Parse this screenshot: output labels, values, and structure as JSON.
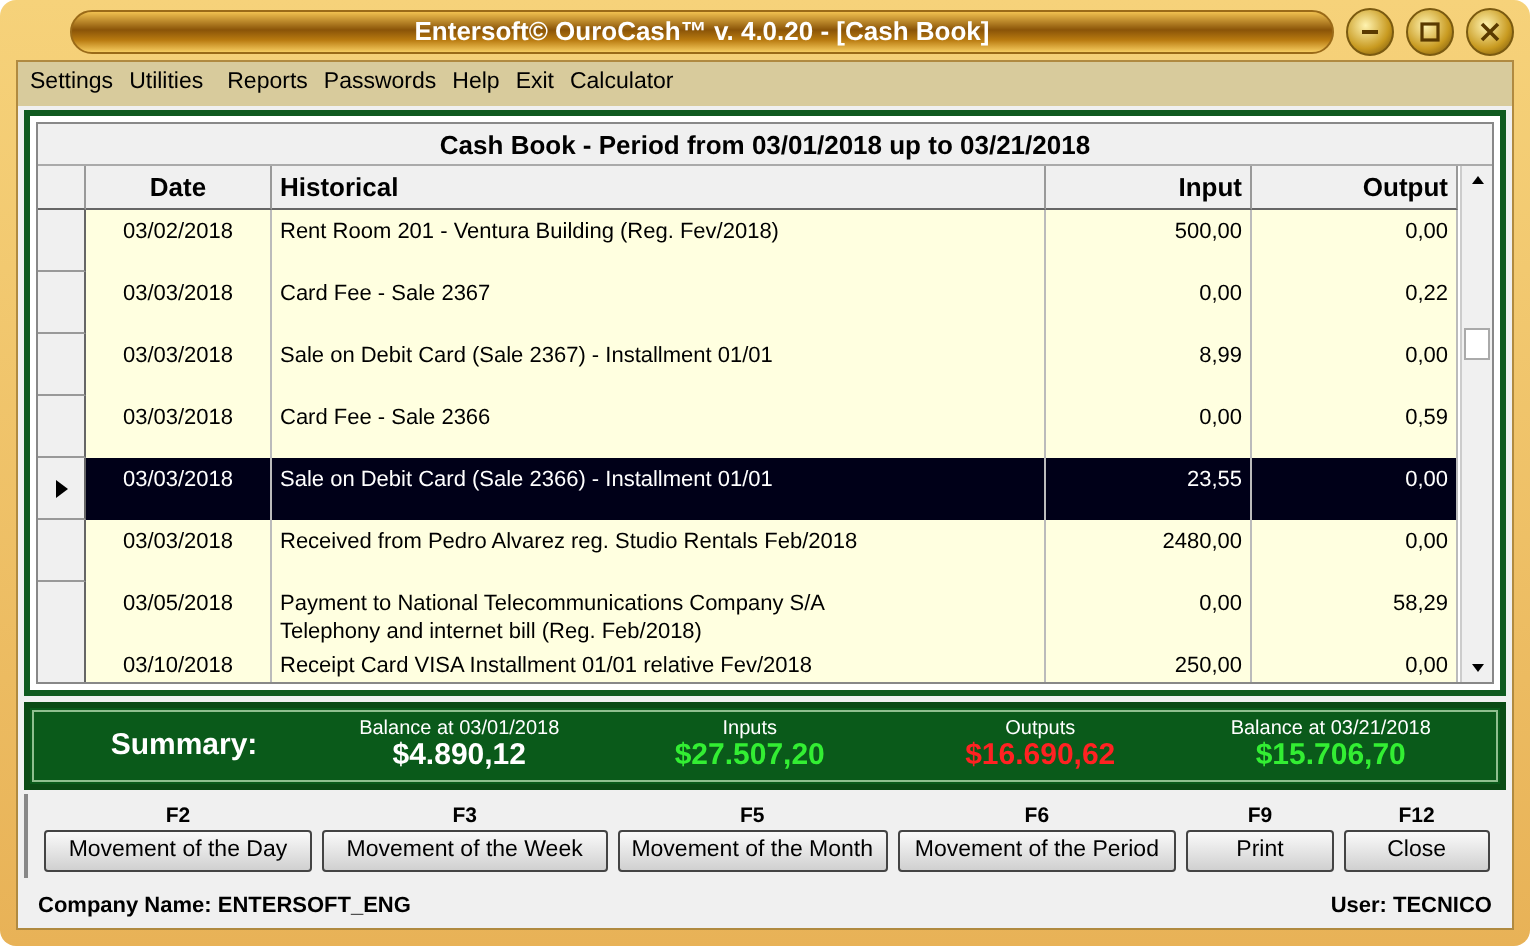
{
  "window": {
    "title": "Entersoft© OuroCash™ v. 4.0.20 - [Cash Book]"
  },
  "menu": [
    "Settings",
    "Utilities",
    "Reports",
    "Passwords",
    "Help",
    "Exit",
    "Calculator"
  ],
  "grid": {
    "title": "Cash Book - Period from 03/01/2018 up to 03/21/2018",
    "columns": [
      "Date",
      "Historical",
      "Input",
      "Output"
    ],
    "rows": [
      {
        "date": "03/02/2018",
        "historical": "Rent Room 201 - Ventura Building (Reg. Fev/2018)",
        "input": "500,00",
        "output": "0,00",
        "selected": false
      },
      {
        "date": "03/03/2018",
        "historical": "Card Fee - Sale 2367",
        "input": "0,00",
        "output": "0,22",
        "selected": false
      },
      {
        "date": "03/03/2018",
        "historical": "Sale on Debit Card (Sale 2367) - Installment 01/01",
        "input": "8,99",
        "output": "0,00",
        "selected": false
      },
      {
        "date": "03/03/2018",
        "historical": "Card Fee - Sale 2366",
        "input": "0,00",
        "output": "0,59",
        "selected": false
      },
      {
        "date": "03/03/2018",
        "historical": "Sale on Debit Card (Sale 2366) - Installment 01/01",
        "input": "23,55",
        "output": "0,00",
        "selected": true
      },
      {
        "date": "03/03/2018",
        "historical": "Received from Pedro Alvarez reg. Studio Rentals Feb/2018",
        "input": "2480,00",
        "output": "0,00",
        "selected": false
      },
      {
        "date": "03/05/2018",
        "historical": "Payment to National Telecommunications Company S/A\nTelephony and internet bill (Reg. Feb/2018)",
        "input": "0,00",
        "output": "58,29",
        "selected": false
      },
      {
        "date": "03/10/2018",
        "historical": "Receipt Card VISA Installment 01/01 relative Fev/2018",
        "input": "250,00",
        "output": "0,00",
        "selected": false
      }
    ]
  },
  "summary": {
    "label": "Summary:",
    "items": [
      {
        "label": "Balance at 03/01/2018",
        "value": "$4.890,12",
        "color": "#ffffff"
      },
      {
        "label": "Inputs",
        "value": "$27.507,20",
        "color": "#33ee33"
      },
      {
        "label": "Outputs",
        "value": "$16.690,62",
        "color": "#ff2222"
      },
      {
        "label": "Balance at 03/21/2018",
        "value": "$15.706,70",
        "color": "#33ee33"
      }
    ]
  },
  "buttons": [
    {
      "key": "F2",
      "label": "Movement of the Day"
    },
    {
      "key": "F3",
      "label": "Movement of the Week"
    },
    {
      "key": "F5",
      "label": "Movement of the Month"
    },
    {
      "key": "F6",
      "label": "Movement of the Period"
    },
    {
      "key": "F9",
      "label": "Print"
    },
    {
      "key": "F12",
      "label": "Close"
    }
  ],
  "status_bar": {
    "company": "Company Name: ENTERSOFT_ENG",
    "user": "User: TECNICO"
  }
}
